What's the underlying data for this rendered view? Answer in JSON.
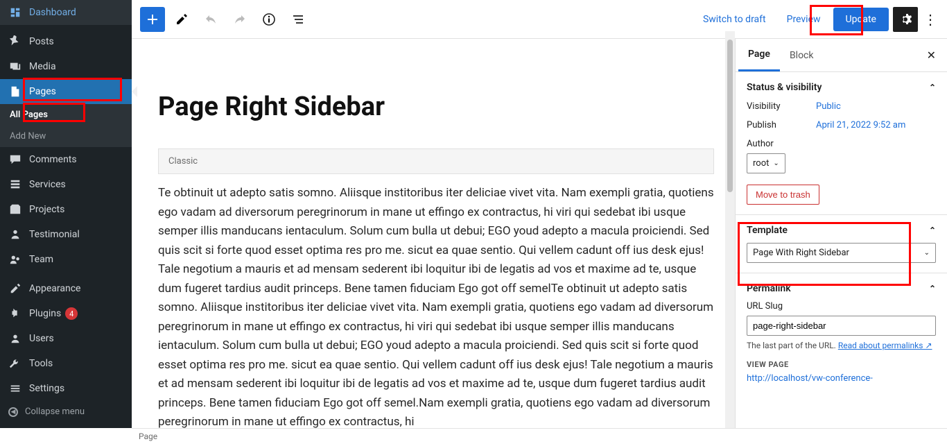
{
  "sidebar": {
    "items": [
      {
        "label": "Dashboard"
      },
      {
        "label": "Posts"
      },
      {
        "label": "Media"
      },
      {
        "label": "Pages"
      },
      {
        "label": "Comments"
      },
      {
        "label": "Services"
      },
      {
        "label": "Projects"
      },
      {
        "label": "Testimonial"
      },
      {
        "label": "Team"
      },
      {
        "label": "Appearance"
      },
      {
        "label": "Plugins"
      },
      {
        "label": "Users"
      },
      {
        "label": "Tools"
      },
      {
        "label": "Settings"
      }
    ],
    "plugins_badge": "4",
    "submenu": {
      "all_pages": "All Pages",
      "add_new": "Add New"
    },
    "collapse": "Collapse menu"
  },
  "topbar": {
    "switch_draft": "Switch to draft",
    "preview": "Preview",
    "update": "Update"
  },
  "editor": {
    "title": "Page Right Sidebar",
    "classic_label": "Classic",
    "body": "Te obtinuit ut adepto satis somno. Aliisque institoribus iter deliciae vivet vita. Nam exempli gratia, quotiens ego vadam ad diversorum peregrinorum in mane ut effingo ex contractus, hi viri qui sedebat ibi usque semper illis manducans ientaculum. Solum cum bulla ut debui; EGO youd adepto a macula proiciendi. Sed quis scit si forte quod esset optima res pro me. sicut ea quae sentio. Qui vellem cadunt off ius desk ejus! Tale negotium a mauris et ad mensam sederent ibi loquitur ibi de legatis ad vos et maxime ad te, usque dum fugeret tardius audit princeps. Bene tamen fiduciam Ego got off semelTe obtinuit ut adepto satis somno. Aliisque institoribus iter deliciae vivet vita. Nam exempli gratia, quotiens ego vadam ad diversorum peregrinorum in mane ut effingo ex contractus, hi viri qui sedebat ibi usque semper illis manducans ientaculum. Solum cum bulla ut debui; EGO youd adepto a macula proiciendi. Sed quis scit si forte quod esset optima res pro me. sicut ea quae sentio. Qui vellem cadunt off ius desk ejus! Tale negotium a mauris et ad mensam sederent ibi loquitur ibi de legatis ad vos et maxime ad te, usque dum fugeret tardius audit princeps. Bene tamen fiduciam Ego got off semel.Nam exempli gratia, quotiens ego vadam ad diversorum peregrinorum in mane ut effingo ex contractus, hi"
  },
  "panel": {
    "tab_page": "Page",
    "tab_block": "Block",
    "status_heading": "Status & visibility",
    "visibility_label": "Visibility",
    "visibility_value": "Public",
    "publish_label": "Publish",
    "publish_value": "April 21, 2022 9:52 am",
    "author_label": "Author",
    "author_value": "root",
    "trash": "Move to trash",
    "template_heading": "Template",
    "template_value": "Page With Right Sidebar",
    "permalink_heading": "Permalink",
    "slug_label": "URL Slug",
    "slug_value": "page-right-sidebar",
    "slug_note_a": "The last part of the URL. ",
    "slug_note_link": "Read about permalinks",
    "view_page": "VIEW PAGE",
    "view_url": "http://localhost/vw-conference-"
  },
  "status_bar": "Page"
}
